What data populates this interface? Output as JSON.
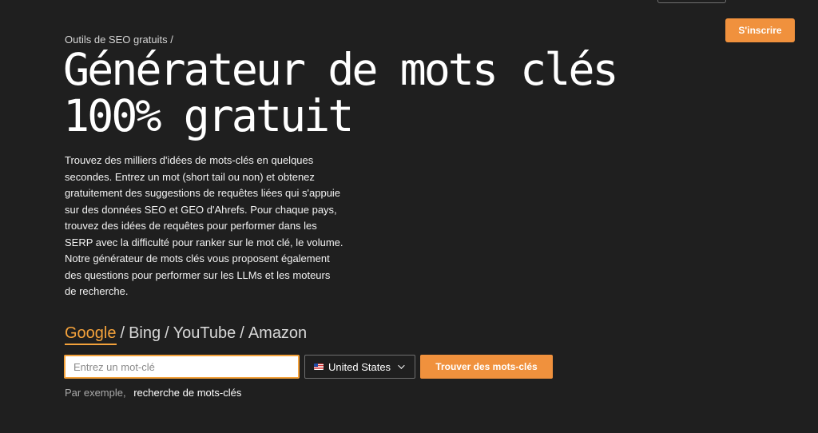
{
  "header": {
    "signup_label": "S'inscrire"
  },
  "breadcrumb": "Outils de SEO gratuits /",
  "hero": {
    "title_line_1": "Générateur de mots clés",
    "title_line_2": "100% gratuit",
    "description": "Trouvez des milliers d'idées de mots-clés en quelques secondes. Entrez un mot (short tail ou non) et obtenez gratuitement des suggestions de requêtes liées qui s'appuie sur des données SEO et GEO d'Ahrefs. Pour chaque pays, trouvez des idées de requêtes pour performer dans les SERP avec la difficulté pour ranker sur le mot clé, le volume. Notre générateur de mots clés vous proposent également des questions pour performer sur les LLMs et les moteurs de recherche."
  },
  "engines": {
    "active": "Google",
    "items": [
      "Google",
      "Bing",
      "YouTube",
      "Amazon"
    ]
  },
  "search": {
    "input_value": "",
    "placeholder": "Entrez un mot-clé",
    "country": "United States",
    "country_flag_icon": "us-flag-icon",
    "chevron_icon": "chevron-down-icon",
    "button_label": "Trouver des mots-clés"
  },
  "example": {
    "label": "Par exemple,",
    "link": "recherche de mots-clés"
  },
  "colors": {
    "background": "#1f1f1f",
    "accent": "#f0913d",
    "active_engine": "#f4a23b"
  }
}
